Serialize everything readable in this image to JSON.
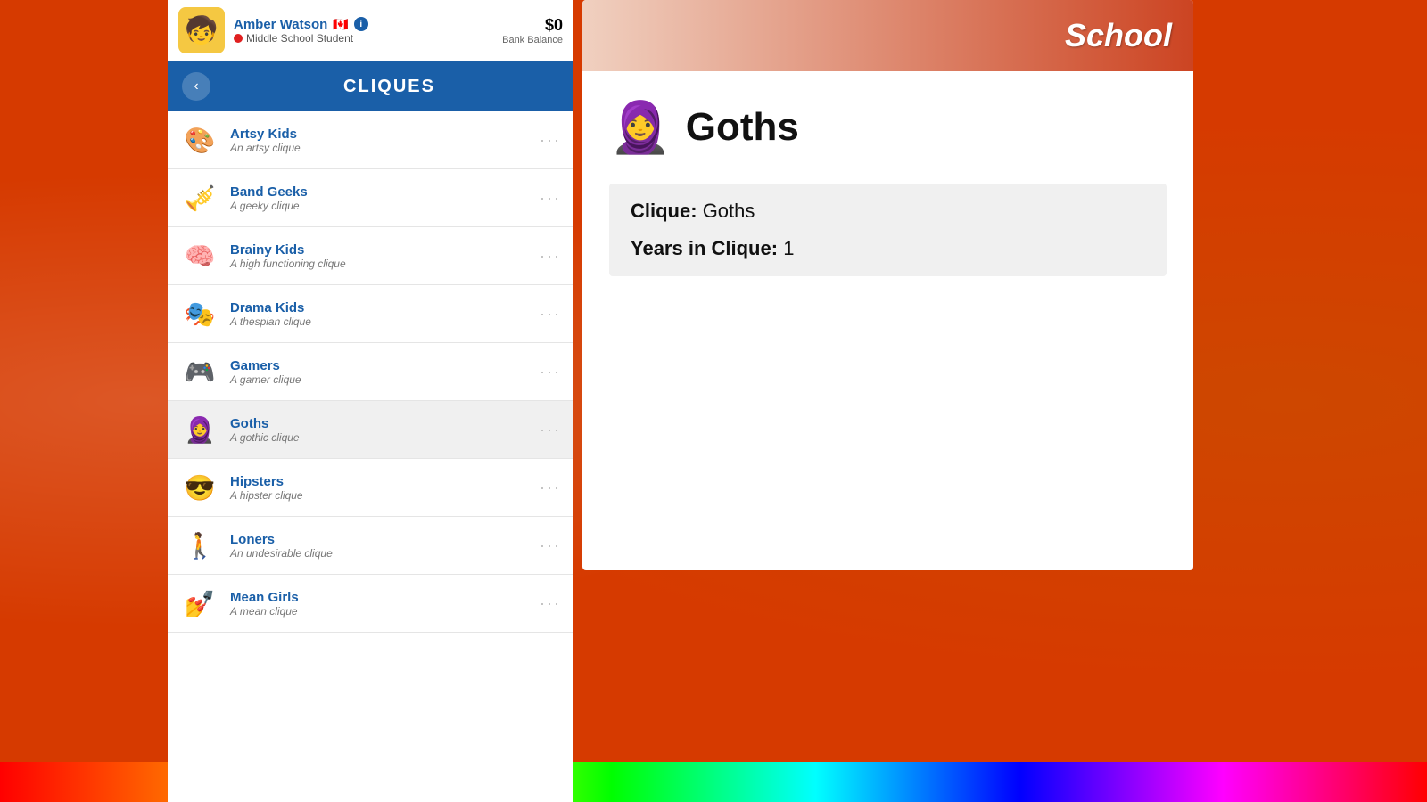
{
  "background": {
    "color": "#d63a00"
  },
  "user": {
    "name": "Amber Watson",
    "role": "Middle School Student",
    "balance": "$0",
    "balance_label": "Bank Balance",
    "avatar_emoji": "🧒",
    "flag": "🇨🇦"
  },
  "header": {
    "back_label": "‹",
    "title": "CLIQUES"
  },
  "cliques": [
    {
      "id": "artsy",
      "name": "Artsy Kids",
      "desc": "An artsy clique",
      "emoji": "🎨"
    },
    {
      "id": "band",
      "name": "Band Geeks",
      "desc": "A geeky clique",
      "emoji": "🎺"
    },
    {
      "id": "brainy",
      "name": "Brainy Kids",
      "desc": "A high functioning clique",
      "emoji": "🧠"
    },
    {
      "id": "drama",
      "name": "Drama Kids",
      "desc": "A thespian clique",
      "emoji": "🎭"
    },
    {
      "id": "gamers",
      "name": "Gamers",
      "desc": "A gamer clique",
      "emoji": "🎮"
    },
    {
      "id": "goths",
      "name": "Goths",
      "desc": "A gothic clique",
      "emoji": "🧕",
      "selected": true
    },
    {
      "id": "hipsters",
      "name": "Hipsters",
      "desc": "A hipster clique",
      "emoji": "😎"
    },
    {
      "id": "loners",
      "name": "Loners",
      "desc": "An undesirable clique",
      "emoji": "🚶"
    },
    {
      "id": "mean_girls",
      "name": "Mean Girls",
      "desc": "A mean clique",
      "emoji": "💅"
    }
  ],
  "detail": {
    "header_title": "School",
    "clique_emoji": "🧕",
    "clique_name": "Goths",
    "info": {
      "clique_label": "Clique:",
      "clique_value": "Goths",
      "years_label": "Years in Clique:",
      "years_value": "1"
    }
  },
  "dots_label": "···"
}
